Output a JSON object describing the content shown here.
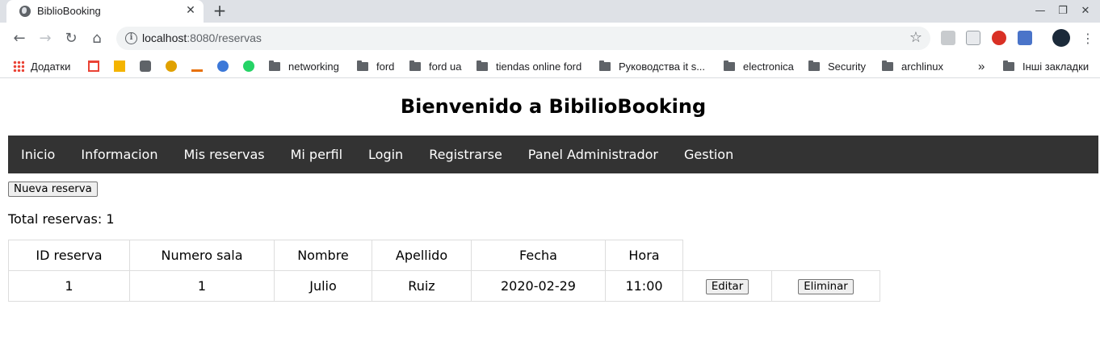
{
  "browser": {
    "tab_title": "BiblioBooking",
    "new_tab_symbol": "+",
    "url_host": "localhost",
    "url_rest": ":8080/reservas",
    "bookmarks": [
      {
        "label": "Додатки",
        "icon": "apps-icon"
      },
      {
        "label": "",
        "icon": "gmail-icon"
      },
      {
        "label": "",
        "icon": "j-icon"
      },
      {
        "label": "",
        "icon": "fox-icon"
      },
      {
        "label": "",
        "icon": "star-badge-icon"
      },
      {
        "label": "",
        "icon": "va-icon"
      },
      {
        "label": "",
        "icon": "qb-icon"
      },
      {
        "label": "",
        "icon": "whatsapp-icon"
      },
      {
        "label": "networking",
        "icon": "folder-icon"
      },
      {
        "label": "ford",
        "icon": "folder-icon"
      },
      {
        "label": "ford ua",
        "icon": "folder-icon"
      },
      {
        "label": "tiendas online ford",
        "icon": "folder-icon"
      },
      {
        "label": "Руководства it s...",
        "icon": "folder-icon"
      },
      {
        "label": "electronica",
        "icon": "folder-icon"
      },
      {
        "label": "Security",
        "icon": "folder-icon"
      },
      {
        "label": "archlinux",
        "icon": "folder-icon"
      }
    ],
    "bookmarks_overflow": "»",
    "other_bookmarks": "Інші закладки",
    "colors": {
      "tabstrip": "#dee1e6",
      "omnibox": "#f1f3f4"
    }
  },
  "page": {
    "title": "Bienvenido a BibilioBooking",
    "nav": [
      "Inicio",
      "Informacion",
      "Mis reservas",
      "Mi perfil",
      "Login",
      "Registrarse",
      "Panel Administrador",
      "Gestion"
    ],
    "new_button": "Nueva reserva",
    "total": "Total reservas: 1",
    "table": {
      "headers": [
        "ID reserva",
        "Numero sala",
        "Nombre",
        "Apellido",
        "Fecha",
        "Hora"
      ],
      "rows": [
        {
          "id": "1",
          "sala": "1",
          "nombre": "Julio",
          "apellido": "Ruiz",
          "fecha": "2020-02-29",
          "hora": "11:00",
          "edit": "Editar",
          "delete": "Eliminar"
        }
      ]
    },
    "colors": {
      "navbar": "#333333",
      "nav_text": "#ffffff"
    }
  }
}
